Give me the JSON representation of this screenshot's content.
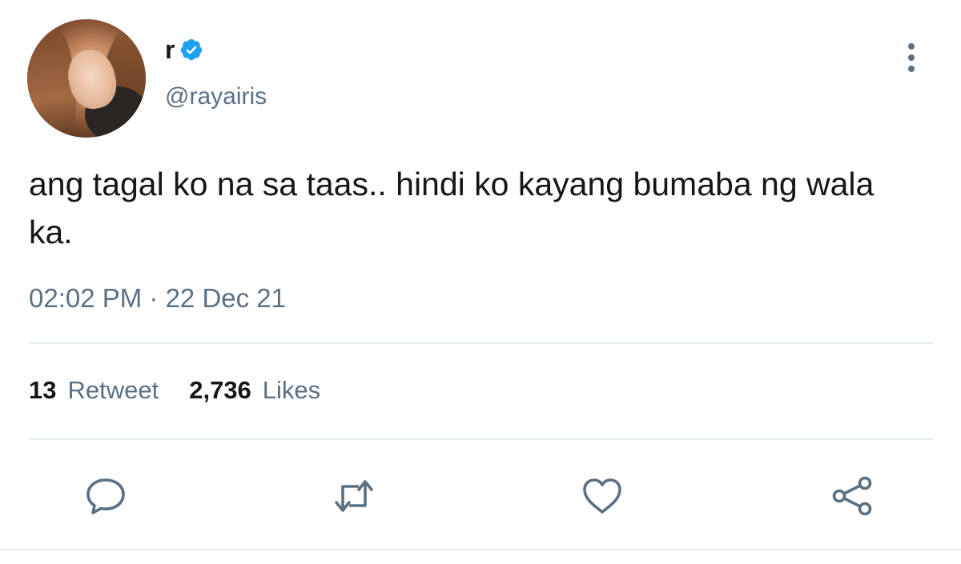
{
  "author": {
    "display_name": "r",
    "handle": "@rayairis",
    "verified_color": "#1da1f2"
  },
  "tweet": {
    "text": "ang tagal ko na sa taas.. hindi ko kayang bumaba ng wala ka.",
    "timestamp": "02:02 PM · 22 Dec 21"
  },
  "stats": {
    "retweet_count": "13",
    "retweet_label": "Retweet",
    "like_count": "2,736",
    "like_label": "Likes"
  },
  "actions": [
    {
      "name": "reply",
      "icon": "comment-icon"
    },
    {
      "name": "retweet",
      "icon": "retweet-icon"
    },
    {
      "name": "like",
      "icon": "heart-icon"
    },
    {
      "name": "share",
      "icon": "share-icon"
    }
  ],
  "colors": {
    "text": "#14171a",
    "secondary": "#5b7083",
    "divider": "#e6ecf0"
  }
}
